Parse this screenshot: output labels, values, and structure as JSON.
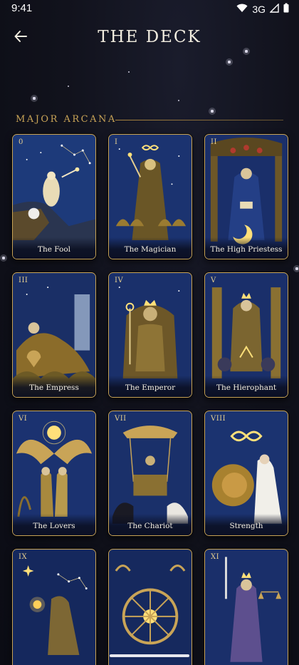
{
  "status_bar": {
    "time": "9:41",
    "network": "3G"
  },
  "header": {
    "title": "THE DECK",
    "back_icon": "arrow-left-icon"
  },
  "section": {
    "title": "MAJOR ARCANA"
  },
  "cards": [
    {
      "numeral": "0",
      "name": "The Fool",
      "motif": "figure-on-cliff"
    },
    {
      "numeral": "I",
      "name": "The Magician",
      "motif": "infinity-robed-figure"
    },
    {
      "numeral": "II",
      "name": "The High Priestess",
      "motif": "seated-priestess-moon"
    },
    {
      "numeral": "III",
      "name": "The Empress",
      "motif": "reclining-figure-waterfall"
    },
    {
      "numeral": "IV",
      "name": "The Emperor",
      "motif": "throne-figure"
    },
    {
      "numeral": "V",
      "name": "The Hierophant",
      "motif": "pillars-enthroned"
    },
    {
      "numeral": "VI",
      "name": "The Lovers",
      "motif": "winged-angel-couple"
    },
    {
      "numeral": "VII",
      "name": "The Chariot",
      "motif": "chariot-sphinxes"
    },
    {
      "numeral": "VIII",
      "name": "Strength",
      "motif": "lion-infinity"
    },
    {
      "numeral": "IX",
      "name": "",
      "motif": "hermit-lantern"
    },
    {
      "numeral": "",
      "name": "",
      "motif": "wheel"
    },
    {
      "numeral": "XI",
      "name": "",
      "motif": "justice-scales"
    }
  ],
  "colors": {
    "accent_gold": "#c9a457",
    "background": "#11121c",
    "card_blue": "#1f3a78"
  }
}
